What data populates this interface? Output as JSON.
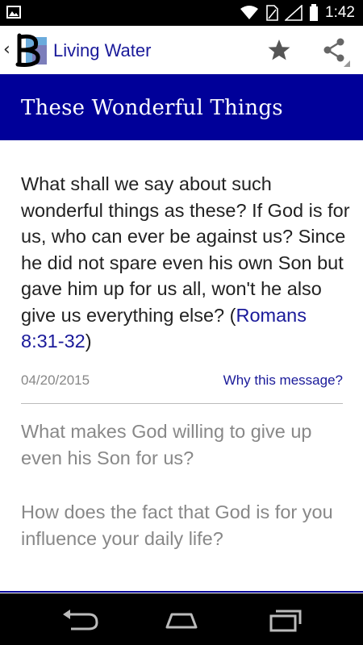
{
  "status_bar": {
    "time": "1:42",
    "icons": [
      "image-icon",
      "wifi-icon",
      "sim-icon",
      "signal-icon",
      "battery-icon"
    ]
  },
  "action_bar": {
    "back_glyph": "‹",
    "app_title": "Living Water",
    "actions": [
      "star-icon",
      "share-icon"
    ]
  },
  "header": {
    "title": "These Wonderful Things"
  },
  "content": {
    "verse_text": "What shall we say about such wonderful things as these? If God is for us, who can ever be against us? Since he did not spare even his own Son but gave him up for us all, won't he also give us everything else? (",
    "verse_reference": "Romans 8:31-32",
    "verse_close": ")",
    "date": "04/20/2015",
    "why_link": "Why this message?",
    "questions": [
      "What makes God willing to give up even his Son for us?",
      "How does the fact that God is for you influence your daily life?"
    ]
  },
  "colors": {
    "brand_blue": "#000099",
    "link_blue": "#1a1a9a",
    "muted_text": "#888888"
  },
  "nav_bar": {
    "buttons": [
      "back-icon",
      "home-icon",
      "recent-apps-icon"
    ]
  }
}
